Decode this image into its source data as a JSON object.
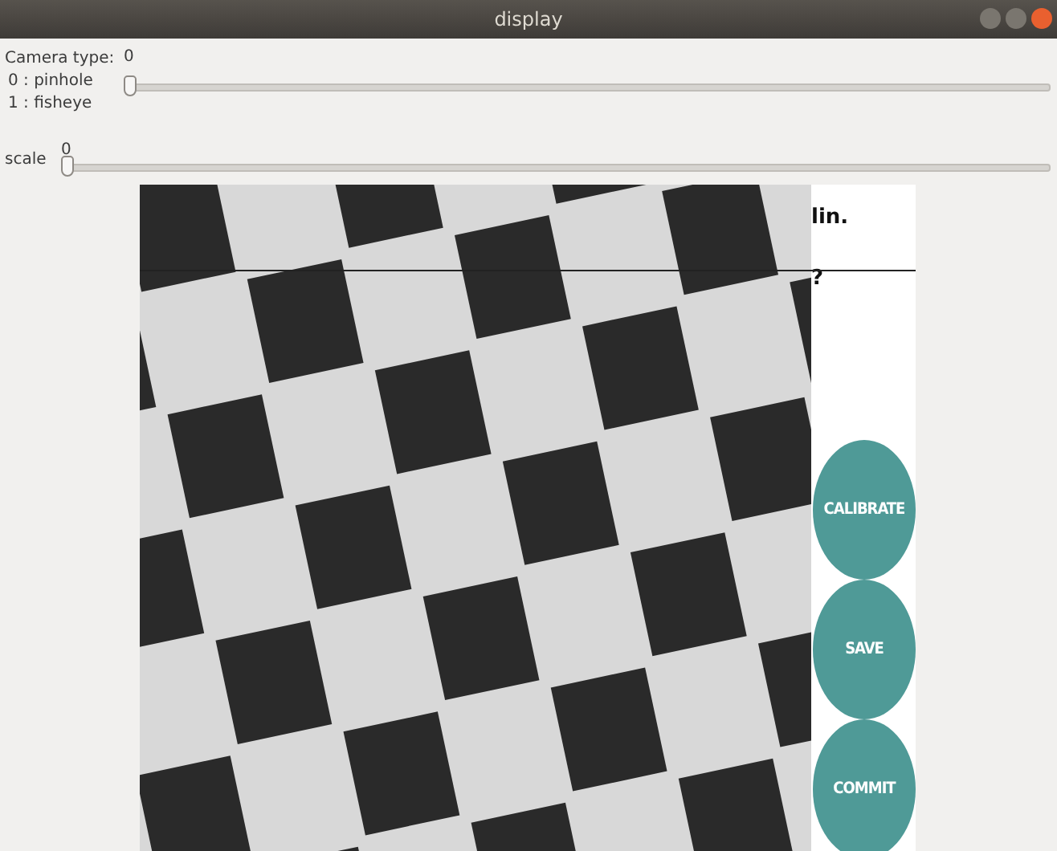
{
  "window": {
    "title": "display"
  },
  "trackbars": [
    {
      "label": "Camera type:",
      "options": [
        "0 : pinhole",
        "1 : fisheye"
      ],
      "value": "0",
      "level": 0
    },
    {
      "label": "scale",
      "value": "0",
      "level": 0
    }
  ],
  "canvas": {
    "texts": [
      "lin.",
      "?"
    ],
    "buttons": [
      "CALIBRATE",
      "SAVE",
      "COMMIT"
    ]
  }
}
